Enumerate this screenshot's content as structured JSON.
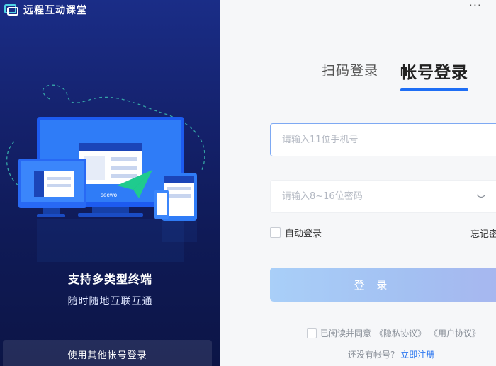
{
  "app": {
    "title": "远程互动课堂"
  },
  "left": {
    "tagline_main": "支持多类型终端",
    "tagline_sub": "随时随地互联互通",
    "other_login": "使用其他帐号登录",
    "illustration_label": "seewo"
  },
  "right": {
    "more_icon": "···",
    "tabs": [
      {
        "label": "扫码登录",
        "active": false
      },
      {
        "label": "帐号登录",
        "active": true
      }
    ],
    "phone": {
      "placeholder": "请输入11位手机号",
      "value": ""
    },
    "password": {
      "placeholder": "请输入8~16位密码",
      "value": ""
    },
    "auto_login": {
      "label": "自动登录",
      "checked": false
    },
    "forgot": "忘记密码",
    "login_button": "登 录",
    "agreement": {
      "prefix": "已阅读并同意",
      "privacy": "《隐私协议》",
      "user": "《用户协议》",
      "checked": false
    },
    "register": {
      "prompt": "还没有帐号?",
      "link": "立即注册"
    }
  },
  "colors": {
    "accent": "#1e6ef5",
    "left_bg_top": "#1a2d87",
    "left_bg_bottom": "#0c1546",
    "button_disabled": "#a9cff8",
    "link": "#2a76f0"
  }
}
